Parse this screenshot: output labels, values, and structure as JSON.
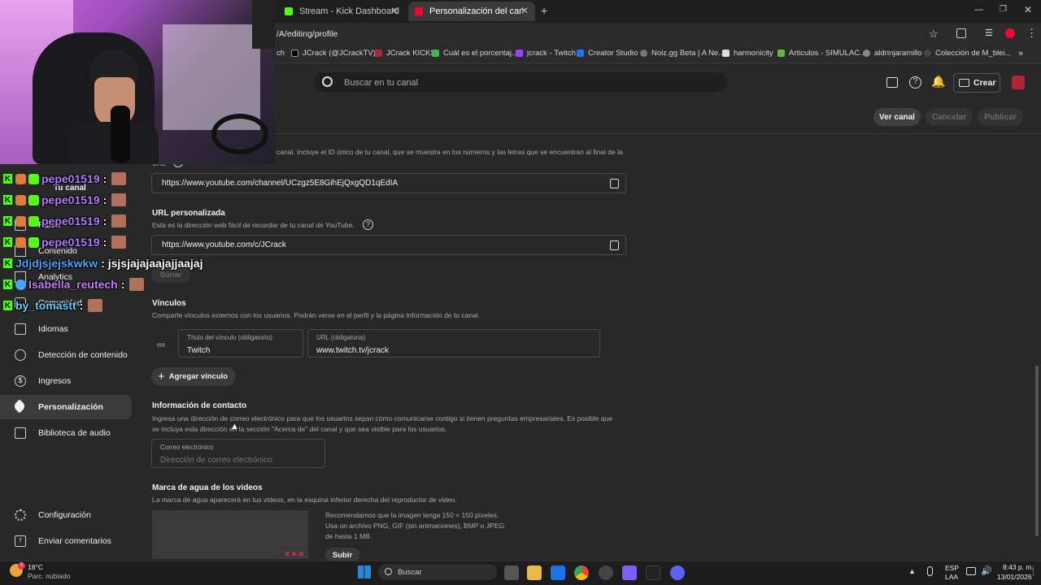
{
  "browser": {
    "tabs": [
      {
        "title": "Stream - Kick Dashboard",
        "color": "#53fc18"
      },
      {
        "title": "Personalización del canal - YouT",
        "color": "#ff0033"
      }
    ],
    "new_tab": "+",
    "url": "/A/editing/profile",
    "bookmarks": [
      "ch",
      "JCrack (@JCrackTV)...",
      "JCrack KICKS",
      "Cuál es el porcentaj...",
      "jcrack - Twitch",
      "Creator Studio",
      "Noiz.gg Beta | A Ne...",
      "harmonicity",
      "Articulos - SIMULAC...",
      "aldrinjaramillo",
      "Colección de M_blei..."
    ],
    "more": "»"
  },
  "header": {
    "search_placeholder": "Buscar en tu canal",
    "create_label": "Crear"
  },
  "subheader": {
    "view_channel": "Ver canal",
    "cancel": "Cancelar",
    "publish": "Publicar"
  },
  "sidebar": {
    "your_channel": "Tu canal",
    "items": [
      {
        "label": "Panel",
        "icon": "dashboard-icon"
      },
      {
        "label": "Contenido",
        "icon": "content-icon"
      },
      {
        "label": "Analytics",
        "icon": "analytics-icon"
      },
      {
        "label": "Comunidad",
        "icon": "community-icon"
      },
      {
        "label": "Idiomas",
        "icon": "subtitles-icon"
      },
      {
        "label": "Detección de contenido",
        "icon": "copyright-icon"
      },
      {
        "label": "Ingresos",
        "icon": "dollar-icon"
      },
      {
        "label": "Personalización",
        "icon": "brush-icon"
      },
      {
        "label": "Biblioteca de audio",
        "icon": "audio-library-icon"
      }
    ],
    "bottom": [
      {
        "label": "Configuración",
        "icon": "gear-icon"
      },
      {
        "label": "Enviar comentarios",
        "icon": "feedback-icon"
      }
    ]
  },
  "main": {
    "channel_url": {
      "desc_partial": "canal. Incluye el ID único de tu canal, que se muestra en los números y las letras que se encuentran al final de la",
      "label_partial": "URL",
      "value": "https://www.youtube.com/channel/UCzgz5E8GihEjQxgQD1qEdIA"
    },
    "custom_url": {
      "title": "URL personalizada",
      "desc": "Esta es la dirección web fácil de recordar de tu canal de YouTube.",
      "value": "https://www.youtube.com/c/JCrack",
      "delete": "Borrar"
    },
    "links": {
      "title": "Vínculos",
      "desc": "Comparte vínculos externos con los usuarios. Podrán verse en el perfil y la página Información de tu canal.",
      "title_label": "Título del vínculo (obligatorio)",
      "title_value": "Twitch",
      "url_label": "URL (obligatoria)",
      "url_value": "www.twitch.tv/jcrack",
      "add": "Agregar vínculo"
    },
    "contact": {
      "title": "Información de contacto",
      "desc1": "Ingresa una dirección de correo electrónico para que los usuarios sepan cómo comunicarse contigo si tienen preguntas empresariales. Es posible que",
      "desc2": "se incluya esta dirección en la sección \"Acerca de\" del canal y que sea visible para los usuarios.",
      "email_label": "Correo electrónico",
      "email_placeholder": "Dirección de correo electrónico"
    },
    "watermark": {
      "title": "Marca de agua de los videos",
      "desc": "La marca de agua aparecerá en tus videos, en la esquina inferior derecha del reproductor de video.",
      "rec1": "Recomendamos que la imagen tenga 150 × 150 píxeles.",
      "rec2": "Usa un archivo PNG, GIF (sin animaciones), BMP o JPEG",
      "rec3": "de hasta 1 MB.",
      "upload": "Subir"
    }
  },
  "chat": [
    {
      "user": "pepe01519",
      "msg": ":",
      "color": "#b57cff"
    },
    {
      "user": "pepe01519",
      "msg": ":",
      "color": "#b57cff"
    },
    {
      "user": "pepe01519",
      "msg": ":",
      "color": "#b57cff"
    },
    {
      "user": "pepe01519",
      "msg": ":",
      "color": "#b57cff"
    },
    {
      "user": "Jdjdjsjejskwkw",
      "msg": ": jsjsjajajaajajjaajaj",
      "color": "#4aa3ff"
    },
    {
      "user": "Isabella_reutech",
      "msg": ":",
      "color": "#c77dff"
    },
    {
      "user": "by_tomastt",
      "msg": ":",
      "color": "#5fd3ff"
    }
  ],
  "taskbar": {
    "temp": "18°C",
    "weather": "Parc. nublado",
    "search": "Buscar",
    "lang1": "ESP",
    "lang2": "LAA",
    "time": "8:43 p. m.",
    "date": "13/01/2026",
    "notif_count": "5"
  },
  "colors": {
    "accent_red": "#ff0033",
    "kick_green": "#53fc18"
  }
}
